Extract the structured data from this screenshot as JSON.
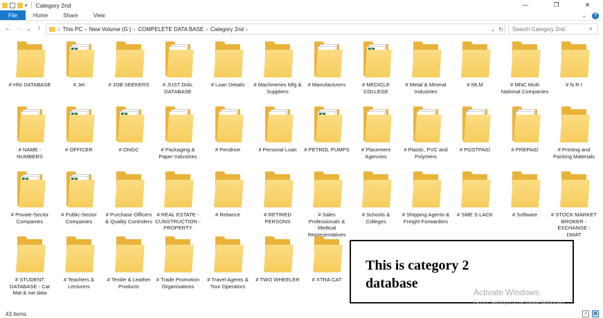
{
  "window": {
    "title": "Category 2nd",
    "controls": {
      "minimize": "—",
      "maximize": "❐",
      "close": "✕"
    }
  },
  "ribbon": {
    "tabs": [
      "File",
      "Home",
      "Share",
      "View"
    ],
    "expand_glyph": "⌄",
    "help_glyph": "?"
  },
  "nav": {
    "back_glyph": "←",
    "forward_glyph": "→",
    "recent_glyph": "⌄",
    "up_glyph": "↑",
    "breadcrumb": [
      "This PC",
      "New Volume (G:)",
      "COMPELETE DATA BASE",
      "Category 2nd"
    ],
    "crumb_separator": "›",
    "dropdown_glyph": "⌄",
    "refresh_glyph": "↻"
  },
  "search": {
    "placeholder": "Search Category 2nd",
    "icon": "search-icon"
  },
  "items": [
    {
      "name": "# HNI DATABASE",
      "icon": "folder"
    },
    {
      "name": "# Jet",
      "icon": "xls"
    },
    {
      "name": "# JOB SEEKERS",
      "icon": "folder"
    },
    {
      "name": "# JUST DIAL DATABASE",
      "icon": "doc"
    },
    {
      "name": "# Loan Details",
      "icon": "folder"
    },
    {
      "name": "# Machineries Mfg & Suppliers",
      "icon": "folder"
    },
    {
      "name": "# Manufacturers",
      "icon": "doc"
    },
    {
      "name": "# MEDICLE COLLEGE",
      "icon": "xls"
    },
    {
      "name": "# Metal & Mineral Industries",
      "icon": "folder"
    },
    {
      "name": "# MLM",
      "icon": "folder"
    },
    {
      "name": "# MNC Multi National Companies",
      "icon": "folder"
    },
    {
      "name": "# N R I",
      "icon": "folder"
    },
    {
      "name": "# NAME - NUMBERS",
      "icon": "doc"
    },
    {
      "name": "# OFFICER",
      "icon": "xls"
    },
    {
      "name": "# ONGC",
      "icon": "xls"
    },
    {
      "name": "# Packaging & Paper Industries",
      "icon": "doc"
    },
    {
      "name": "# Pendrive",
      "icon": "doc"
    },
    {
      "name": "# Personal Loan",
      "icon": "txt"
    },
    {
      "name": "# PETROL PUMPS",
      "icon": "xls"
    },
    {
      "name": "# Placement Agencies",
      "icon": "doc"
    },
    {
      "name": "# Plastic, PVC and Polymers",
      "icon": "doc"
    },
    {
      "name": "# POSTPAID",
      "icon": "doc"
    },
    {
      "name": "# PREPAID",
      "icon": "doc"
    },
    {
      "name": "# Printing and Packing Materials",
      "icon": "folder"
    },
    {
      "name": "# Private-Sector Companies",
      "icon": "xls"
    },
    {
      "name": "# Public-Sector Companies",
      "icon": "xls"
    },
    {
      "name": "# Purchase Officers & Quality Controlers",
      "icon": "folder"
    },
    {
      "name": "# REAL ESTATE - CUNSTRUCTION - PROPERTY",
      "icon": "folder"
    },
    {
      "name": "# Reliance",
      "icon": "folder"
    },
    {
      "name": "# RETIRED PERSONS",
      "icon": "folder"
    },
    {
      "name": "# Sales Professionals & Medical Representatives",
      "icon": "folder"
    },
    {
      "name": "# Schools & Colleges",
      "icon": "folder"
    },
    {
      "name": "# Shipping Agents & Freight Forwarders",
      "icon": "folder"
    },
    {
      "name": "# SME S LACK",
      "icon": "folder"
    },
    {
      "name": "# Software",
      "icon": "folder"
    },
    {
      "name": "# STOCK MARKET BROKER - EXCHANGE - DMAT",
      "icon": "folder"
    },
    {
      "name": "# STUDENT DATABASE - Cat Mat & xat data",
      "icon": "folder"
    },
    {
      "name": "# Teachers & Lecturers",
      "icon": "folder"
    },
    {
      "name": "# Textile & Leather Products",
      "icon": "folder"
    },
    {
      "name": "# Trade Promotion Organisations",
      "icon": "folder"
    },
    {
      "name": "# Travel Agents & Tour Operators",
      "icon": "folder"
    },
    {
      "name": "# TWO WHEELER",
      "icon": "folder"
    },
    {
      "name": "# XTRA CAT",
      "icon": "folder"
    }
  ],
  "overlay": {
    "line1": "This is category 2",
    "line2": "database"
  },
  "watermark": {
    "title": "Activate Windows",
    "subtitle": "Go to Settings to activate Windows."
  },
  "status": {
    "count": "43 items"
  }
}
